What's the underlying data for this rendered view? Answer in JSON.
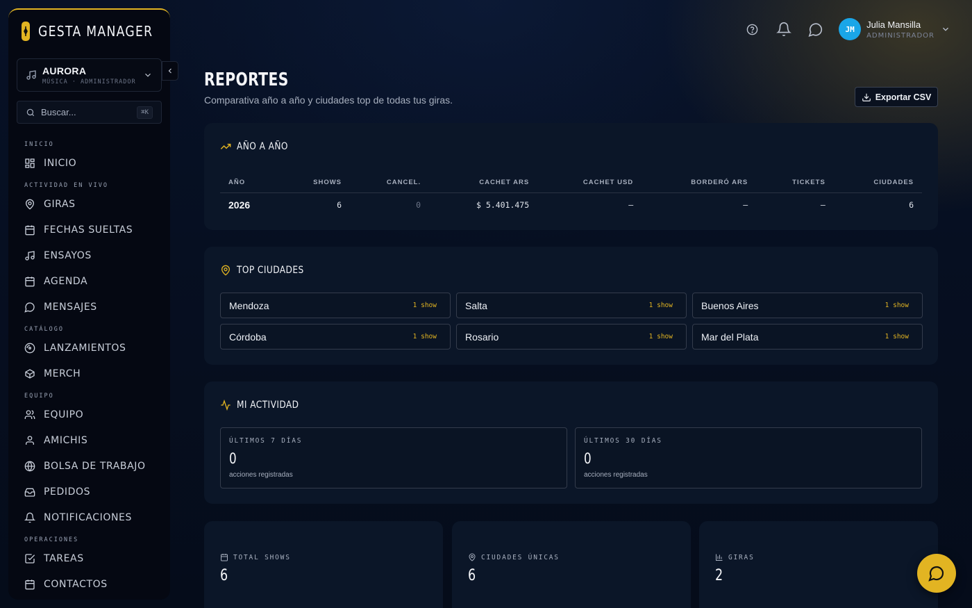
{
  "brand": {
    "name": "GESTA MANAGER"
  },
  "workspace": {
    "name": "AURORA",
    "subtitle": "MÚSICA · ADMINISTRADOR"
  },
  "search": {
    "placeholder": "Buscar...",
    "shortcut": "⌘K"
  },
  "nav": {
    "sections": [
      {
        "label": "INICIO",
        "items": [
          {
            "label": "INICIO",
            "icon": "grid-icon"
          }
        ]
      },
      {
        "label": "ACTIVIDAD EN VIVO",
        "items": [
          {
            "label": "GIRAS",
            "icon": "map-pin-icon"
          },
          {
            "label": "FECHAS SUELTAS",
            "icon": "calendar-icon"
          },
          {
            "label": "ENSAYOS",
            "icon": "music-note-icon"
          },
          {
            "label": "AGENDA",
            "icon": "calendar-icon"
          },
          {
            "label": "MENSAJES",
            "icon": "chat-bubble-icon"
          }
        ]
      },
      {
        "label": "CATÁLOGO",
        "items": [
          {
            "label": "LANZAMIENTOS",
            "icon": "disc-icon"
          },
          {
            "label": "MERCH",
            "icon": "box-icon"
          }
        ]
      },
      {
        "label": "EQUIPO",
        "items": [
          {
            "label": "EQUIPO",
            "icon": "users-icon"
          },
          {
            "label": "AMICHIS",
            "icon": "user-icon"
          },
          {
            "label": "BOLSA DE TRABAJO",
            "icon": "globe-icon"
          },
          {
            "label": "PEDIDOS",
            "icon": "inbox-icon"
          },
          {
            "label": "NOTIFICACIONES",
            "icon": "bell-icon"
          }
        ]
      },
      {
        "label": "OPERACIONES",
        "items": [
          {
            "label": "TAREAS",
            "icon": "checkbox-icon"
          },
          {
            "label": "CONTACTOS",
            "icon": "calendar-icon"
          }
        ]
      }
    ]
  },
  "user": {
    "initials": "JM",
    "name": "Julia Mansilla",
    "role": "ADMINISTRADOR"
  },
  "page": {
    "title": "REPORTES",
    "subtitle": "Comparativa año a año y ciudades top de todas tus giras.",
    "export_label": "Exportar CSV"
  },
  "yoy": {
    "title": "AÑO A AÑO",
    "columns": [
      "AÑO",
      "SHOWS",
      "CANCEL.",
      "CACHET ARS",
      "CACHET USD",
      "BORDERÓ ARS",
      "TICKETS",
      "CIUDADES"
    ],
    "rows": [
      [
        "2026",
        "6",
        "0",
        "$ 5.401.475",
        "—",
        "—",
        "—",
        "6"
      ]
    ]
  },
  "top_cities": {
    "title": "TOP CIUDADES",
    "items": [
      {
        "name": "Mendoza",
        "count": "1 show"
      },
      {
        "name": "Salta",
        "count": "1 show"
      },
      {
        "name": "Buenos Aires",
        "count": "1 show"
      },
      {
        "name": "Córdoba",
        "count": "1 show"
      },
      {
        "name": "Rosario",
        "count": "1 show"
      },
      {
        "name": "Mar del Plata",
        "count": "1 show"
      }
    ]
  },
  "activity": {
    "title": "MI ACTIVIDAD",
    "boxes": [
      {
        "label": "ÚLTIMOS 7 DÍAS",
        "value": "0",
        "note": "acciones registradas"
      },
      {
        "label": "ÚLTIMOS 30 DÍAS",
        "value": "0",
        "note": "acciones registradas"
      }
    ]
  },
  "stats": [
    {
      "label": "TOTAL SHOWS",
      "value": "6",
      "icon": "calendar-icon"
    },
    {
      "label": "CIUDADES ÚNICAS",
      "value": "6",
      "icon": "map-pin-icon"
    },
    {
      "label": "GIRAS",
      "value": "2",
      "icon": "bar-chart-icon"
    }
  ],
  "colors": {
    "accent": "#e2b422",
    "avatar": "#1aa6e8",
    "card": "#0b1628",
    "background": "#050d1c"
  }
}
